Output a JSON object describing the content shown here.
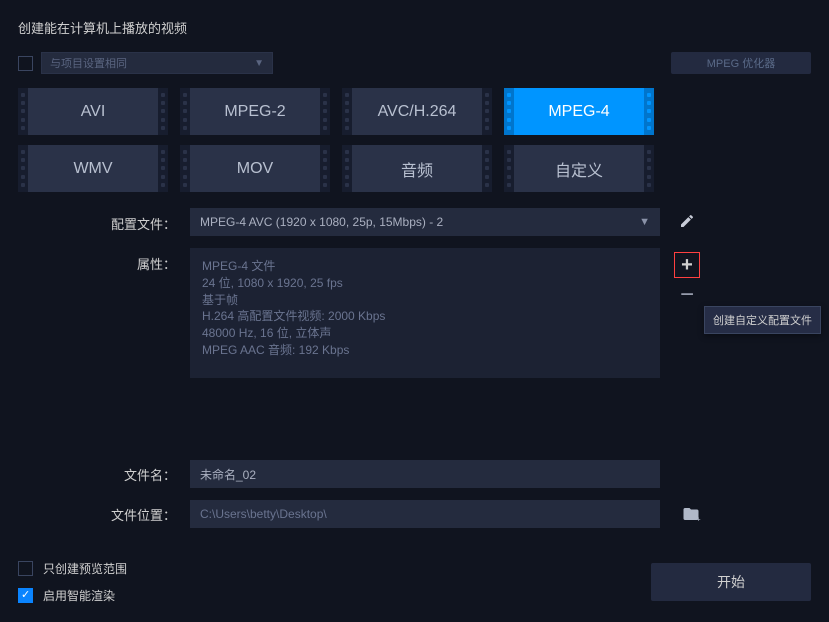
{
  "title": "创建能在计算机上播放的视频",
  "projectSame": {
    "label": "与项目设置相同"
  },
  "mpegOptimizer": "MPEG 优化器",
  "formats": {
    "r1c1": "AVI",
    "r1c2": "MPEG-2",
    "r1c3": "AVC/H.264",
    "r1c4": "MPEG-4",
    "r2c1": "WMV",
    "r2c2": "MOV",
    "r2c3": "音频",
    "r2c4": "自定义"
  },
  "config": {
    "profileLabel": "配置文件：",
    "profileValue": "MPEG-4 AVC (1920 x 1080, 25p, 15Mbps) - 2",
    "attrLabel": "属性：",
    "attrLines": {
      "l1": "MPEG-4 文件",
      "l2": "24 位, 1080 x 1920, 25 fps",
      "l3": "基于帧",
      "l4": "H.264 高配置文件视频: 2000 Kbps",
      "l5": "48000 Hz, 16 位, 立体声",
      "l6": "MPEG AAC 音频: 192 Kbps"
    },
    "tooltip": "创建自定义配置文件"
  },
  "file": {
    "nameLabel": "文件名：",
    "nameValue": "未命名_02",
    "locLabel": "文件位置：",
    "locValue": "C:\\Users\\betty\\Desktop\\"
  },
  "footer": {
    "previewOnly": "只创建预览范围",
    "smartRender": "启用智能渲染",
    "start": "开始"
  }
}
